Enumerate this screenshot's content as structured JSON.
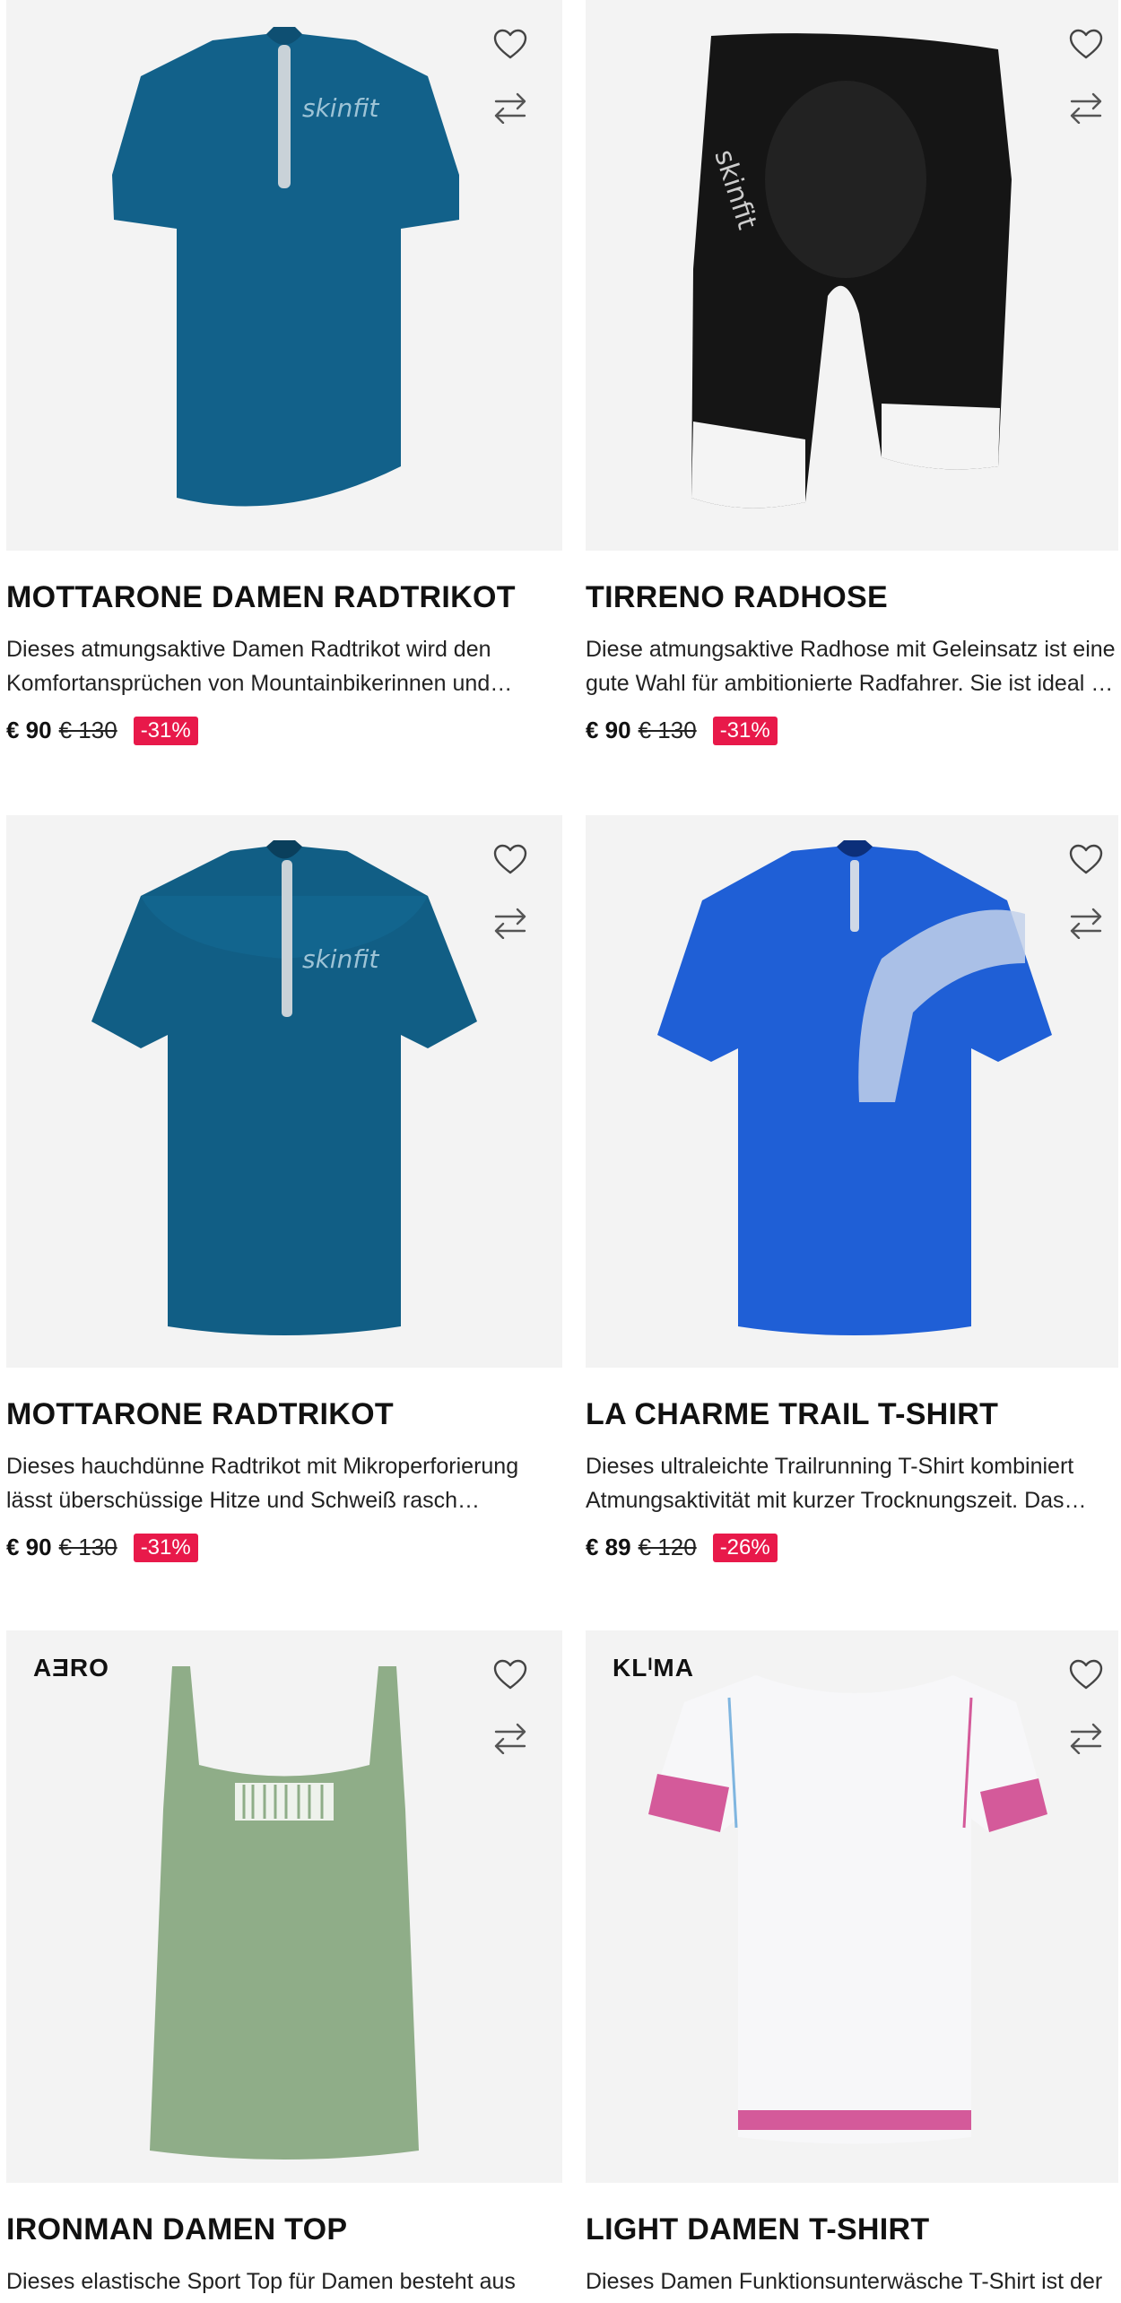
{
  "colors": {
    "badge": "#e8194a",
    "image_bg": "#f3f3f3"
  },
  "icons": {
    "wishlist": "heart-icon",
    "compare": "compare-arrows-icon"
  },
  "products": [
    {
      "title": "MOTTARONE DAMEN RADTRIKOT",
      "desc_line1": "Dieses atmungsaktive Damen Radtrikot wird den",
      "desc_line2": "Komfortansprüchen von Mountainbikerinnen und…",
      "price": "€ 90",
      "old_price": "€ 130",
      "discount": "-31%",
      "brand_tag": ""
    },
    {
      "title": "TIRRENO RADHOSE",
      "desc_line1": "Diese atmungsaktive Radhose mit Geleinsatz ist eine",
      "desc_line2": "gute Wahl für ambitionierte Radfahrer. Sie ist ideal für…",
      "price": "€ 90",
      "old_price": "€ 130",
      "discount": "-31%",
      "brand_tag": ""
    },
    {
      "title": "MOTTARONE RADTRIKOT",
      "desc_line1": "Dieses hauchdünne Radtrikot mit Mikroperforierung",
      "desc_line2": "lässt überschüssige Hitze und Schweiß rasch…",
      "price": "€ 90",
      "old_price": "€ 130",
      "discount": "-31%",
      "brand_tag": ""
    },
    {
      "title": "LA CHARME TRAIL T-SHIRT",
      "desc_line1": "Dieses ultraleichte Trailrunning T-Shirt kombiniert",
      "desc_line2": "Atmungsaktivität mit kurzer Trocknungszeit. Das…",
      "price": "€ 89",
      "old_price": "€ 120",
      "discount": "-26%",
      "brand_tag": ""
    },
    {
      "title": "IRONMAN DAMEN TOP",
      "desc_line1": "Dieses elastische Sport Top für Damen besteht aus",
      "desc_line2": "",
      "price": "",
      "old_price": "",
      "discount": "",
      "brand_tag": "AƎRO"
    },
    {
      "title": "LIGHT DAMEN T-SHIRT",
      "desc_line1": "Dieses Damen Funktionsunterwäsche T-Shirt ist der",
      "desc_line2": "",
      "price": "",
      "old_price": "",
      "discount": "",
      "brand_tag": "KLᴵMA"
    }
  ]
}
